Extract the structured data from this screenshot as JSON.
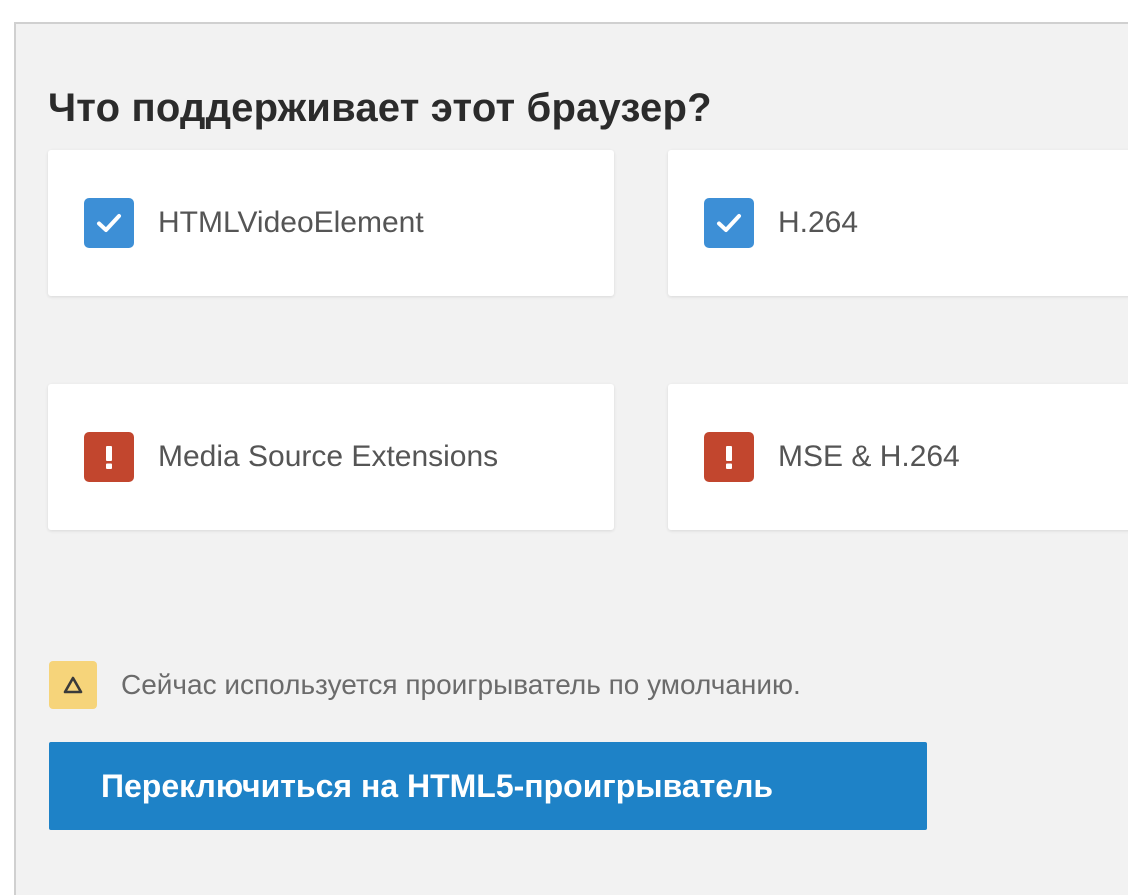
{
  "title": "Что поддерживает этот браузер?",
  "features": [
    {
      "label": "HTMLVideoElement",
      "supported": true,
      "icon": "checkbox-checked-icon"
    },
    {
      "label": "H.264",
      "supported": true,
      "icon": "checkbox-checked-icon"
    },
    {
      "label": "Media Source Extensions",
      "supported": false,
      "icon": "error-exclamation-icon"
    },
    {
      "label": "MSE & H.264",
      "supported": false,
      "icon": "error-exclamation-icon"
    }
  ],
  "notice": {
    "icon": "warning-triangle-icon",
    "text": "Сейчас используется проигрыватель по умолчанию."
  },
  "switch_button": {
    "label": "Переключиться на HTML5-проигрыватель"
  },
  "colors": {
    "check_blue": "#3d8fd6",
    "error_red": "#c2462e",
    "warning_yellow": "#f6d47a",
    "button_blue": "#1e82c7",
    "panel_gray": "#f2f2f2"
  }
}
